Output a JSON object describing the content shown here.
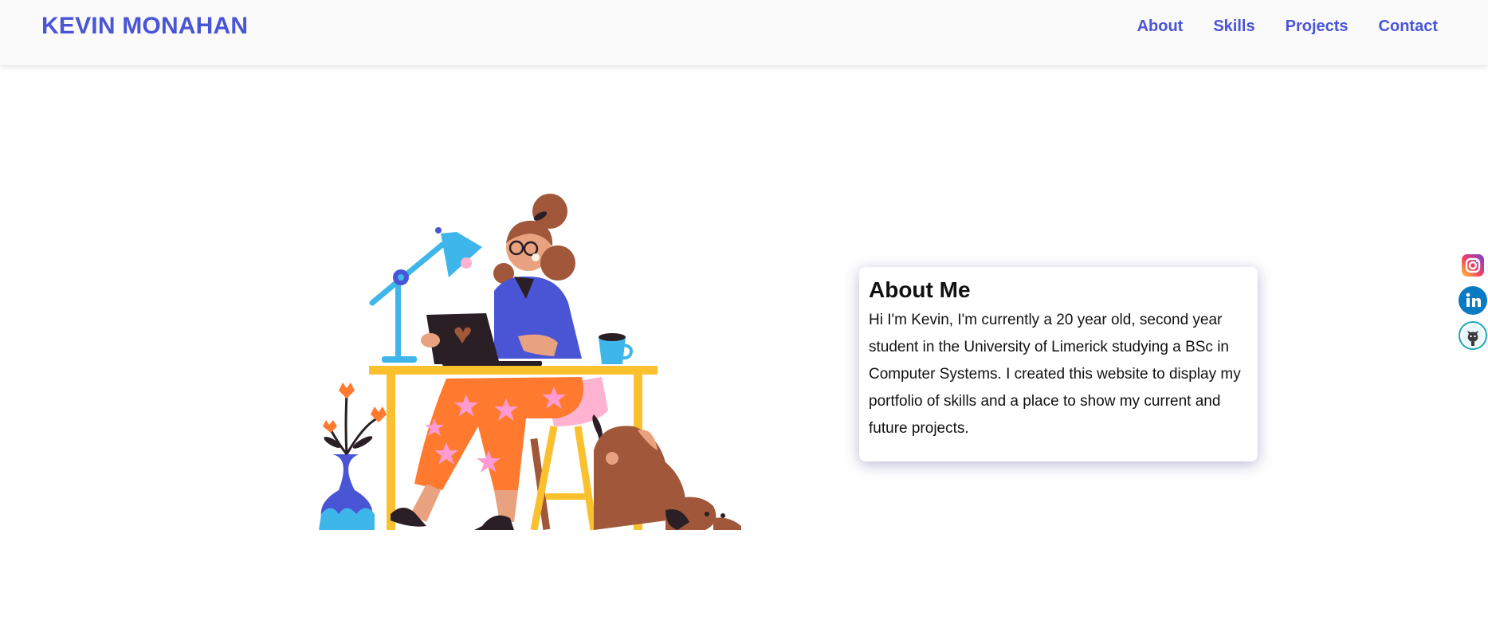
{
  "header": {
    "brand": "KEVIN MONAHAN",
    "nav": [
      "About",
      "Skills",
      "Projects",
      "Contact"
    ]
  },
  "about": {
    "title": "About Me",
    "text": "Hi I'm Kevin, I'm currently a 20 year old, second year student in the University of Limerick studying a BSc in Computer Systems. I created this website to display my portfolio of skills and a place to show my current and future projects."
  },
  "social": [
    {
      "name": "instagram-icon"
    },
    {
      "name": "linkedin-icon"
    },
    {
      "name": "github-icon"
    }
  ],
  "colors": {
    "accent": "#4a55d6",
    "navbar_bg": "#fafafa"
  }
}
